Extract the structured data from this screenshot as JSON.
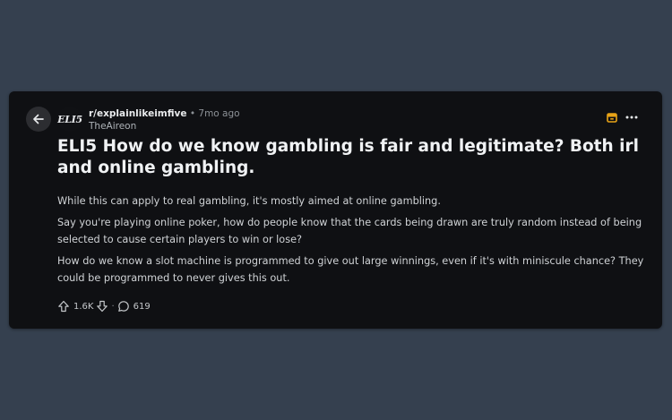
{
  "post": {
    "subreddit": "r/explainlikeimfive",
    "subreddit_icon_text": "ELI5",
    "separator": "•",
    "age": "7mo ago",
    "author": "TheAireon",
    "title": "ELI5 How do we know gambling is fair and legitimate? Both irl and online gambling.",
    "body": [
      "While this can apply to real gambling, it's mostly aimed at online gambling.",
      "Say you're playing online poker, how do people know that the cards being drawn are truly random instead of being selected to cause certain players to win or lose?",
      "How do we know a slot machine is programmed to give out large winnings, even if it's with miniscule chance? They could be programmed to never gives this out."
    ],
    "votes": "1.6K",
    "comments": "619",
    "action_separator": "·"
  },
  "icons": {
    "back": "arrow-left-icon",
    "award": "award-icon",
    "more": "more-horizontal-icon",
    "upvote": "upvote-arrow-icon",
    "downvote": "downvote-arrow-icon",
    "comment": "comment-bubble-icon"
  },
  "colors": {
    "page_background": "#35404f",
    "card_background": "#0f1013",
    "award_accent": "#e8a317"
  }
}
